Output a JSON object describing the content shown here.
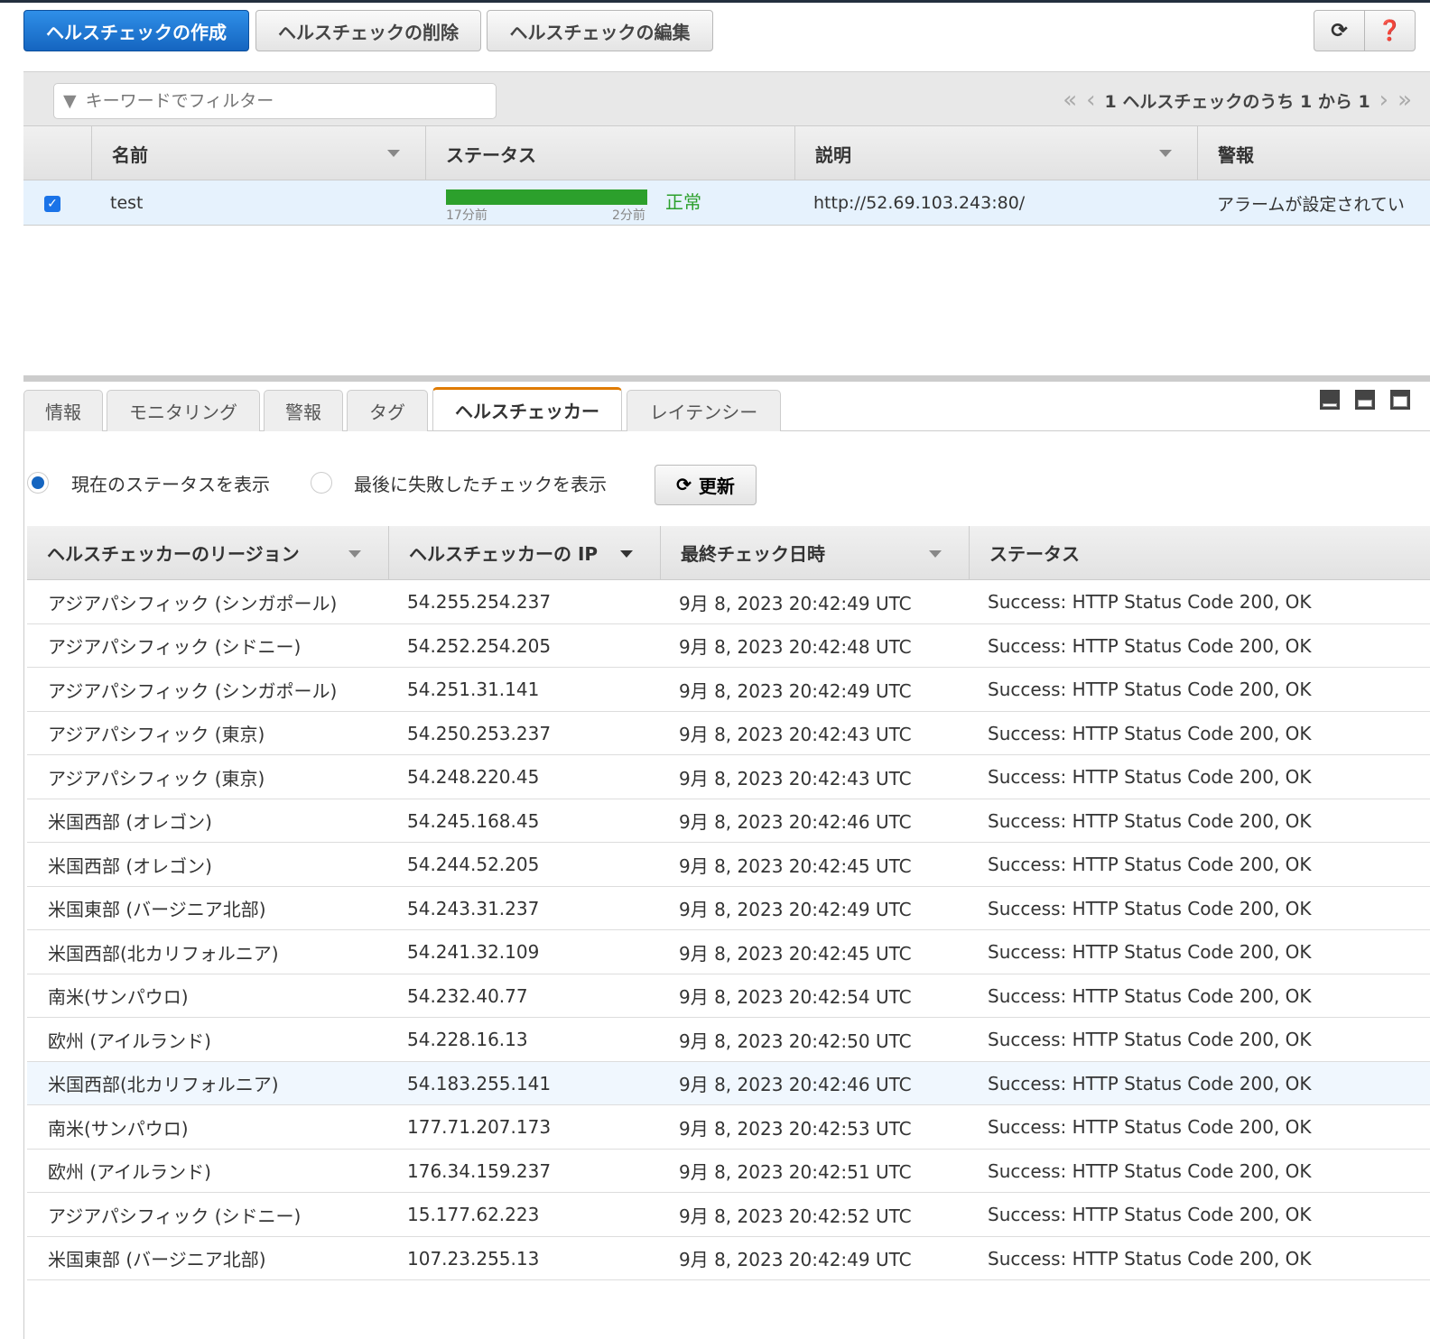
{
  "toolbar": {
    "create": "ヘルスチェックの作成",
    "delete": "ヘルスチェックの削除",
    "edit": "ヘルスチェックの編集",
    "refresh_icon": "refresh-icon",
    "help_icon": "help-icon"
  },
  "filter": {
    "placeholder": "キーワードでフィルター"
  },
  "pager": {
    "text": "1 ヘルスチェックのうち 1 から 1"
  },
  "top_table": {
    "columns": [
      "名前",
      "ステータス",
      "説明",
      "警報"
    ],
    "rows": [
      {
        "checked": true,
        "name": "test",
        "status_start": "17分前",
        "status_end": "2分前",
        "status": "正常",
        "description": "http://52.69.103.243:80/",
        "alarm": "アラームが設定されてい"
      }
    ]
  },
  "colors": {
    "accent": "#1565c0",
    "healthy": "#2ca02c",
    "tab_active": "#e07b00"
  },
  "tabs": [
    "情報",
    "モニタリング",
    "警報",
    "タグ",
    "ヘルスチェッカー",
    "レイテンシー"
  ],
  "active_tab": "ヘルスチェッカー",
  "view": {
    "current": "現在のステータスを表示",
    "last_failed": "最後に失敗したチェックを表示",
    "refresh": "更新"
  },
  "checkers": {
    "columns": [
      "ヘルスチェッカーのリージョン",
      "ヘルスチェッカーの IP",
      "最終チェック日時",
      "ステータス"
    ],
    "rows": [
      [
        "アジアパシフィック (シンガポール)",
        "54.255.254.237",
        "9月 8, 2023 20:42:49 UTC",
        "Success: HTTP Status Code 200, OK"
      ],
      [
        "アジアパシフィック (シドニー)",
        "54.252.254.205",
        "9月 8, 2023 20:42:48 UTC",
        "Success: HTTP Status Code 200, OK"
      ],
      [
        "アジアパシフィック (シンガポール)",
        "54.251.31.141",
        "9月 8, 2023 20:42:49 UTC",
        "Success: HTTP Status Code 200, OK"
      ],
      [
        "アジアパシフィック (東京)",
        "54.250.253.237",
        "9月 8, 2023 20:42:43 UTC",
        "Success: HTTP Status Code 200, OK"
      ],
      [
        "アジアパシフィック (東京)",
        "54.248.220.45",
        "9月 8, 2023 20:42:43 UTC",
        "Success: HTTP Status Code 200, OK"
      ],
      [
        "米国西部 (オレゴン)",
        "54.245.168.45",
        "9月 8, 2023 20:42:46 UTC",
        "Success: HTTP Status Code 200, OK"
      ],
      [
        "米国西部 (オレゴン)",
        "54.244.52.205",
        "9月 8, 2023 20:42:45 UTC",
        "Success: HTTP Status Code 200, OK"
      ],
      [
        "米国東部 (バージニア北部)",
        "54.243.31.237",
        "9月 8, 2023 20:42:49 UTC",
        "Success: HTTP Status Code 200, OK"
      ],
      [
        "米国西部(北カリフォルニア)",
        "54.241.32.109",
        "9月 8, 2023 20:42:45 UTC",
        "Success: HTTP Status Code 200, OK"
      ],
      [
        "南米(サンパウロ)",
        "54.232.40.77",
        "9月 8, 2023 20:42:54 UTC",
        "Success: HTTP Status Code 200, OK"
      ],
      [
        "欧州 (アイルランド)",
        "54.228.16.13",
        "9月 8, 2023 20:42:50 UTC",
        "Success: HTTP Status Code 200, OK"
      ],
      [
        "米国西部(北カリフォルニア)",
        "54.183.255.141",
        "9月 8, 2023 20:42:46 UTC",
        "Success: HTTP Status Code 200, OK"
      ],
      [
        "南米(サンパウロ)",
        "177.71.207.173",
        "9月 8, 2023 20:42:53 UTC",
        "Success: HTTP Status Code 200, OK"
      ],
      [
        "欧州 (アイルランド)",
        "176.34.159.237",
        "9月 8, 2023 20:42:51 UTC",
        "Success: HTTP Status Code 200, OK"
      ],
      [
        "アジアパシフィック (シドニー)",
        "15.177.62.223",
        "9月 8, 2023 20:42:52 UTC",
        "Success: HTTP Status Code 200, OK"
      ],
      [
        "米国東部 (バージニア北部)",
        "107.23.255.13",
        "9月 8, 2023 20:42:49 UTC",
        "Success: HTTP Status Code 200, OK"
      ]
    ],
    "highlighted_row": 11
  }
}
